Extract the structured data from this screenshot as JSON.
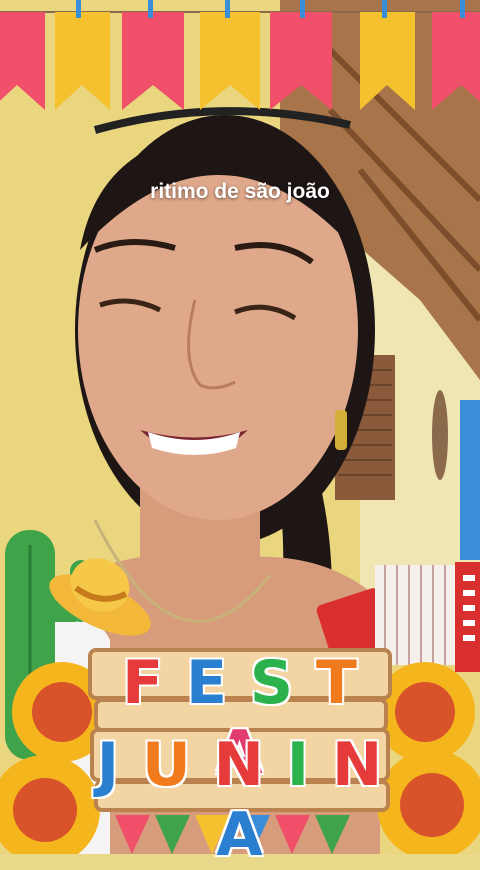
{
  "caption": "ritimo de são joão",
  "sticker": {
    "line1": [
      "F",
      "E",
      "S",
      "T",
      "A"
    ],
    "line2": [
      "J",
      "U",
      "N",
      "I",
      "N",
      "A"
    ],
    "line1_colors": [
      "#e63b3b",
      "#2a7fd1",
      "#2bb24c",
      "#f07a1c",
      "#e23b6d"
    ],
    "line2_colors": [
      "#2a7fd1",
      "#f07a1c",
      "#e63b3b",
      "#2bb24c",
      "#e63b3b",
      "#2a7fd1"
    ]
  },
  "bunting_colors": [
    "#f0506a",
    "#f6c12f",
    "#f0506a",
    "#f6c12f",
    "#f0506a",
    "#f6c12f",
    "#f0506a"
  ]
}
